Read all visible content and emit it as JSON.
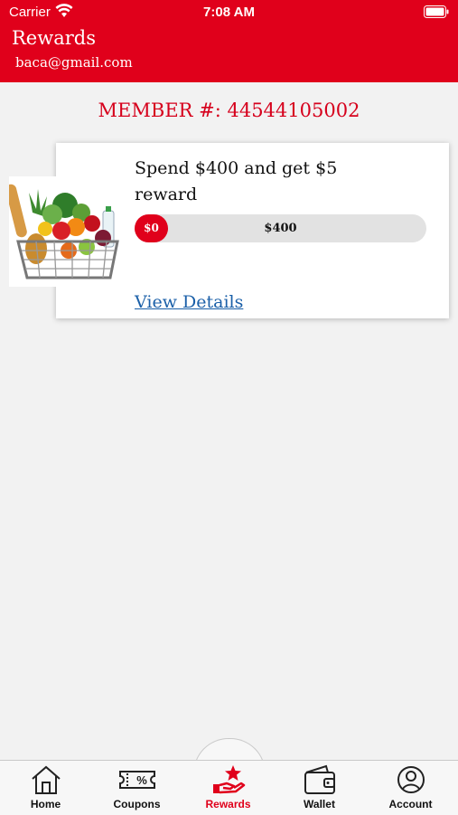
{
  "status_bar": {
    "carrier": "Carrier",
    "time": "7:08 AM"
  },
  "header": {
    "title": "Rewards",
    "email": "baca@gmail.com"
  },
  "member": {
    "label": "MEMBER #: 44544105002"
  },
  "reward": {
    "title": "Spend $400 and get $5 reward",
    "progress": {
      "start_label": "$0",
      "goal_label": "$400",
      "fraction": 0
    },
    "view_details": "View Details",
    "image_icon": "grocery-basket-icon"
  },
  "tabs": [
    {
      "label": "Home",
      "icon": "home-icon"
    },
    {
      "label": "Coupons",
      "icon": "coupon-icon"
    },
    {
      "label": "Rewards",
      "icon": "rewards-icon",
      "active": true
    },
    {
      "label": "Wallet",
      "icon": "wallet-icon"
    },
    {
      "label": "Account",
      "icon": "account-icon"
    }
  ],
  "colors": {
    "brand": "#e0001b",
    "link": "#1a5fa8",
    "background": "#f2f2f2"
  }
}
